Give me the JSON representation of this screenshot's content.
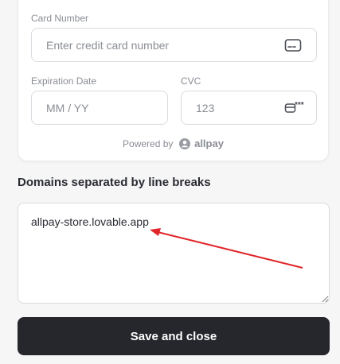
{
  "payment_form": {
    "card_number": {
      "label": "Card Number",
      "placeholder": "Enter credit card number",
      "icon": "credit-card-icon"
    },
    "expiration": {
      "label": "Expiration Date",
      "placeholder": "MM / YY"
    },
    "cvc": {
      "label": "CVC",
      "placeholder": "123",
      "icon": "card-cvc-icon"
    },
    "powered_by": {
      "text": "Powered by",
      "brand": "allpay",
      "icon": "allpay-logo-icon"
    }
  },
  "domains": {
    "title": "Domains separated by line breaks",
    "value": "allpay-store.lovable.app"
  },
  "annotation": {
    "color": "#e0262a"
  },
  "actions": {
    "save_label": "Save and close"
  }
}
